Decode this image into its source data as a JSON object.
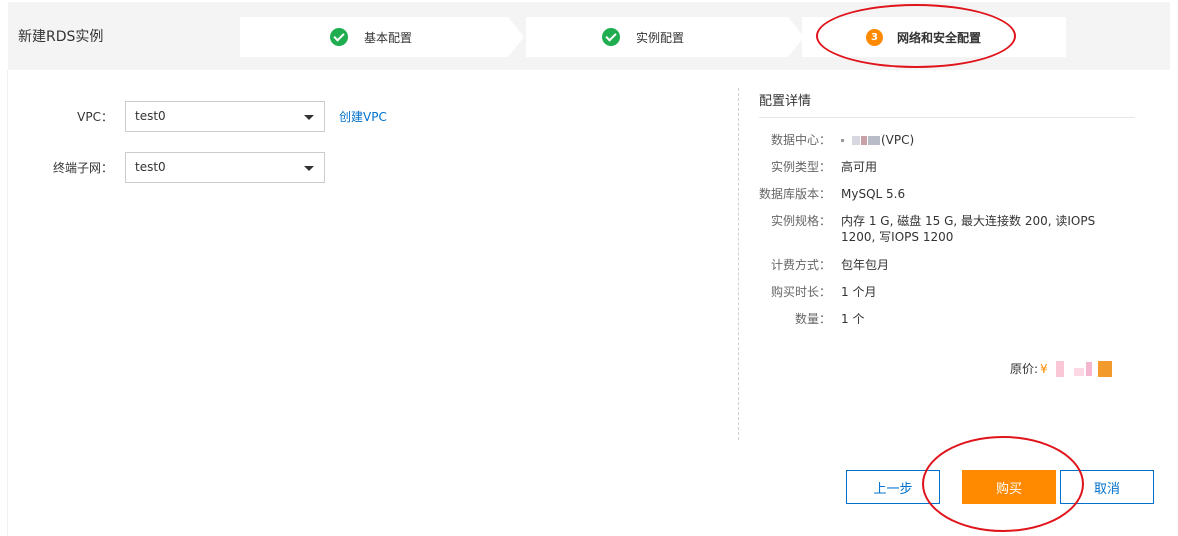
{
  "header": {
    "title": "新建RDS实例",
    "steps": [
      {
        "label": "基本配置",
        "state": "done"
      },
      {
        "label": "实例配置",
        "state": "done"
      },
      {
        "label": "网络和安全配置",
        "state": "current",
        "number": "3"
      }
    ]
  },
  "form": {
    "vpc": {
      "label": "VPC：",
      "value": "test0",
      "create_link": "创建VPC"
    },
    "subnet": {
      "label": "终端子网：",
      "value": "test0"
    }
  },
  "details": {
    "title": "配置详情",
    "items": [
      {
        "label": "数据中心：",
        "value": "(VPC)"
      },
      {
        "label": "实例类型：",
        "value": "高可用"
      },
      {
        "label": "数据库版本：",
        "value": "MySQL 5.6"
      },
      {
        "label": "实例规格：",
        "value": "内存 1 G, 磁盘 15 G, 最大连接数 200, 读IOPS 1200, 写IOPS 1200"
      },
      {
        "label": "计费方式：",
        "value": "包年包月"
      },
      {
        "label": "购买时长：",
        "value": "1 个月"
      },
      {
        "label": "数量：",
        "value": "1 个"
      }
    ],
    "price": {
      "label": "原价:",
      "currency": "¥"
    }
  },
  "buttons": {
    "prev": "上一步",
    "buy": "购买",
    "cancel": "取消"
  },
  "colors": {
    "accent_blue": "#0070cc",
    "accent_orange": "#ff8a00",
    "success_green": "#1fad4f",
    "annotation_red": "#e0141b",
    "header_bg": "#f4f4f4"
  }
}
